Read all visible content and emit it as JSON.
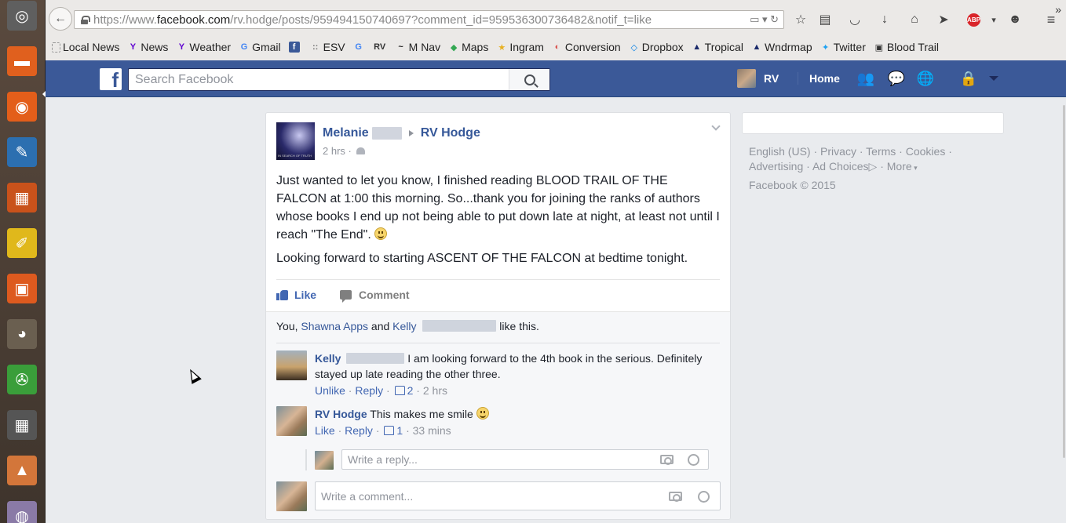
{
  "colors": {
    "fb_blue": "#3b5998",
    "link": "#365899",
    "meta": "#90949c",
    "bg": "#e9ebee"
  },
  "launcher": {
    "items": [
      {
        "name": "ubuntu-dash-icon",
        "color": "#5f5f5f"
      },
      {
        "name": "files-icon",
        "color": "#e0601e"
      },
      {
        "name": "firefox-icon",
        "color": "#e35e1a"
      },
      {
        "name": "libreoffice-writer-icon",
        "color": "#2c6fb0"
      },
      {
        "name": "libreoffice-impress-icon",
        "color": "#c9521b"
      },
      {
        "name": "text-editor-icon",
        "color": "#e0b81b"
      },
      {
        "name": "software-center-icon",
        "color": "#dd5a1f"
      },
      {
        "name": "gimp-icon",
        "color": "#6a5f50"
      },
      {
        "name": "media-tool-icon",
        "color": "#3a9e3a"
      },
      {
        "name": "calculator-icon",
        "color": "#555555"
      },
      {
        "name": "archive-manager-icon",
        "color": "#d3763a"
      },
      {
        "name": "disk-utility-icon",
        "color": "#8a7aa6"
      }
    ]
  },
  "browser": {
    "url_scheme": "https://www.",
    "url_host": "facebook.com",
    "url_path": "/rv.hodge/posts/959494150740697?comment_id=959536300736482&notif_t=like",
    "bookmarks": [
      {
        "label": "Local News",
        "icon": "page-icon",
        "glyph": "",
        "color": "#888888"
      },
      {
        "label": "News",
        "icon": "yahoo-icon",
        "glyph": "Y",
        "color": "#5f01d1"
      },
      {
        "label": "Weather",
        "icon": "yahoo-icon",
        "glyph": "Y",
        "color": "#5f01d1"
      },
      {
        "label": "Gmail",
        "icon": "google-icon",
        "glyph": "G",
        "color": "#4285f4"
      },
      {
        "label": "",
        "icon": "facebook-icon",
        "glyph": "f",
        "color": "#3b5998"
      },
      {
        "label": "ESV",
        "icon": "esv-icon",
        "glyph": "::",
        "color": "#777777"
      },
      {
        "label": "",
        "icon": "google-icon",
        "glyph": "G",
        "color": "#4285f4"
      },
      {
        "label": "",
        "icon": "rv-icon",
        "glyph": "RV",
        "color": "#333333"
      },
      {
        "label": "M Nav",
        "icon": "boat-icon",
        "glyph": "~",
        "color": "#222222"
      },
      {
        "label": "Maps",
        "icon": "maps-icon",
        "glyph": "◆",
        "color": "#34a853"
      },
      {
        "label": "Ingram",
        "icon": "ingram-icon",
        "glyph": "★",
        "color": "#e8b020"
      },
      {
        "label": "Conversion",
        "icon": "conversion-icon",
        "glyph": "◐",
        "color": "#d9534f"
      },
      {
        "label": "Dropbox",
        "icon": "dropbox-icon",
        "glyph": "◇",
        "color": "#007ee5"
      },
      {
        "label": "Tropical",
        "icon": "tropical-icon",
        "glyph": "▲",
        "color": "#1a2a6a"
      },
      {
        "label": "Wndrmap",
        "icon": "windmap-icon",
        "glyph": "▲",
        "color": "#1a2a6a"
      },
      {
        "label": "Twitter",
        "icon": "twitter-icon",
        "glyph": "✦",
        "color": "#1da1f2"
      },
      {
        "label": "Blood Trail",
        "icon": "book-icon",
        "glyph": "▣",
        "color": "#333333"
      }
    ],
    "more": "»"
  },
  "fb": {
    "logo": "f",
    "search_placeholder": "Search Facebook",
    "user": "RV",
    "home": "Home"
  },
  "post": {
    "author": "Melanie",
    "target": "RV Hodge",
    "time": "2 hrs ·",
    "avatar_caption": "IN SEARCH OF TRUTH",
    "paragraph1": "Just wanted to let you know, I finished reading BLOOD TRAIL OF THE FALCON at 1:00 this morning. So...thank you for joining the ranks of authors whose books I end up not being able to put down late at night, at least not until I reach \"The End\".",
    "paragraph2": "Looking forward to starting ASCENT OF THE FALCON at bedtime tonight.",
    "like": "Like",
    "comment": "Comment",
    "likes_prefix": "You, ",
    "likes_name1": "Shawna Apps",
    "likes_and": " and ",
    "likes_name2": "Kelly",
    "likes_suffix": " like this."
  },
  "comments": [
    {
      "name": "Kelly",
      "text": "I am looking forward to the 4th book in the serious. Definitely stayed up late reading the other three.",
      "action1": "Unlike",
      "action2": "Reply",
      "likes": "2",
      "time": "2 hrs"
    },
    {
      "name": "RV Hodge",
      "text": "This makes me smile",
      "action1": "Like",
      "action2": "Reply",
      "likes": "1",
      "time": "33 mins"
    }
  ],
  "reply_placeholder": "Write a reply...",
  "comment_placeholder": "Write a comment...",
  "footer": {
    "l1": "English (US)",
    "l2": "Privacy",
    "l3": "Terms",
    "l4": "Cookies",
    "l5": "Advertising",
    "l6": "Ad Choices",
    "l7": "More",
    "copyright": "Facebook © 2015"
  }
}
